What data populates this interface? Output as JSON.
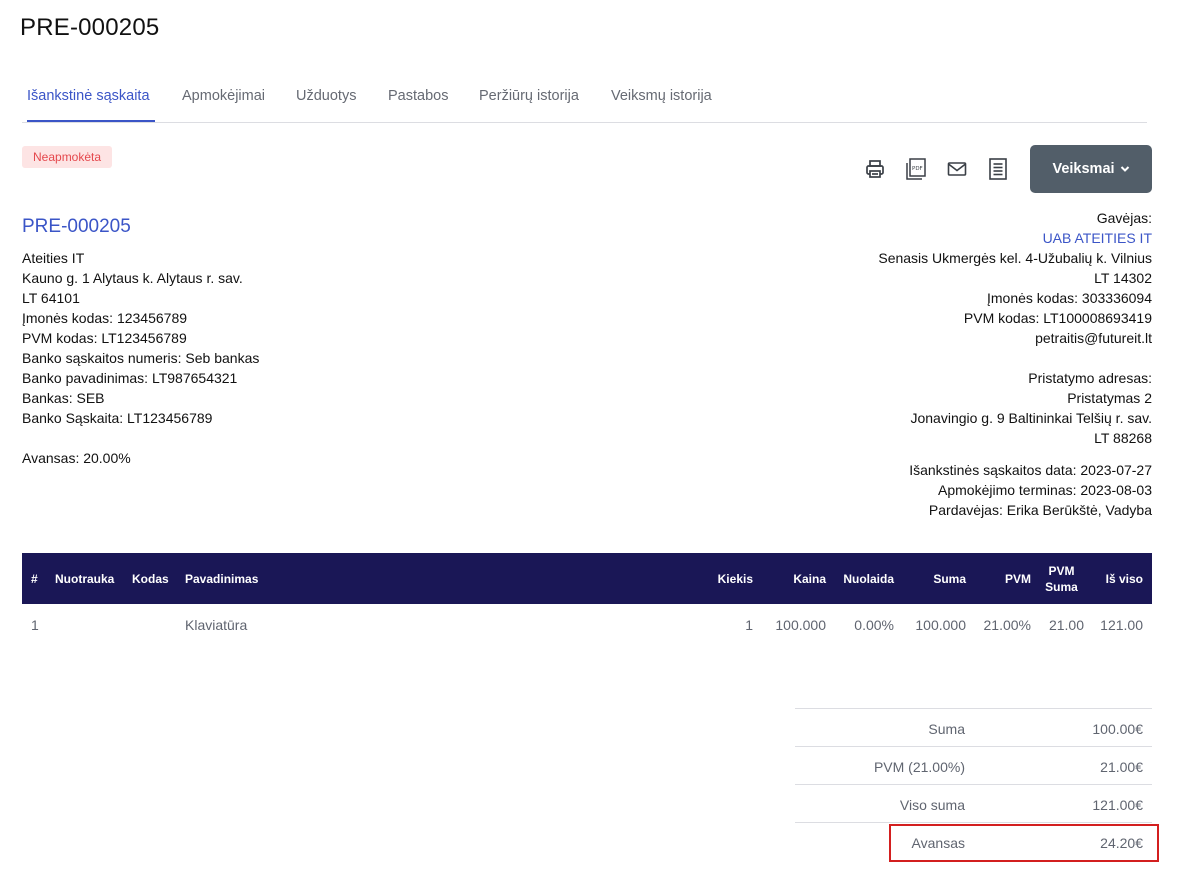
{
  "page": {
    "title": "PRE-000205"
  },
  "tabs": [
    {
      "label": "Išankstinė sąskaita"
    },
    {
      "label": "Apmokėjimai"
    },
    {
      "label": "Užduotys"
    },
    {
      "label": "Pastabos"
    },
    {
      "label": "Peržiūrų istorija"
    },
    {
      "label": "Veiksmų istorija"
    }
  ],
  "status": {
    "label": "Neapmokėta"
  },
  "toolbar": {
    "icons": [
      "printer-icon",
      "pdf-icon",
      "mail-icon",
      "receipt-icon"
    ],
    "actions_label": "Veiksmai"
  },
  "invoice": {
    "number": "PRE-000205"
  },
  "seller": {
    "name": "Ateities IT",
    "address": "Kauno g. 1 Alytaus k. Alytaus r. sav.",
    "postcode": "LT 64101",
    "company_code": "Įmonės kodas: 123456789",
    "vat_code": "PVM kodas: LT123456789",
    "bank_account_number": "Banko sąskaitos numeris: Seb bankas",
    "bank_name": "Banko pavadinimas: LT987654321",
    "bank": "Bankas: SEB",
    "bank_account": "Banko Sąskaita: LT123456789",
    "advance": "Avansas: 20.00%"
  },
  "buyer": {
    "label": "Gavėjas:",
    "name": "UAB ATEITIES IT",
    "address": "Senasis Ukmergės kel. 4-Užubalių k. Vilnius",
    "postcode": "LT 14302",
    "company_code": "Įmonės kodas: 303336094",
    "vat_code": "PVM kodas: LT100008693419",
    "email": "petraitis@futureit.lt",
    "delivery_label": "Pristatymo adresas:",
    "delivery_name": "Pristatymas 2",
    "delivery_address": "Jonavingio g. 9 Baltininkai Telšių r. sav.",
    "delivery_postcode": "LT 88268",
    "invoice_date": "Išankstinės sąskaitos data: 2023-07-27",
    "payment_term": "Apmokėjimo terminas: 2023-08-03",
    "salesperson": "Pardavėjas: Erika Berūkštė, Vadyba"
  },
  "table": {
    "headers": {
      "num": "#",
      "image": "Nuotrauka",
      "code": "Kodas",
      "name": "Pavadinimas",
      "qty": "Kiekis",
      "price": "Kaina",
      "discount": "Nuolaida",
      "sum": "Suma",
      "vat": "PVM",
      "vat_sum_1": "PVM",
      "vat_sum_2": "Suma",
      "total": "Iš viso"
    },
    "rows": [
      {
        "num": "1",
        "image": "",
        "code": "",
        "name": "Klaviatūra",
        "qty": "1",
        "price": "100.000",
        "discount": "0.00%",
        "sum": "100.000",
        "vat": "21.00%",
        "vat_sum": "21.00",
        "total": "121.00"
      }
    ]
  },
  "totals": {
    "sum_label": "Suma",
    "sum_value": "100.00€",
    "vat_label": "PVM (21.00%)",
    "vat_value": "21.00€",
    "grand_label": "Viso suma",
    "grand_value": "121.00€",
    "advance_label": "Avansas",
    "advance_value": "24.20€"
  },
  "colors": {
    "accent": "#3b55c7",
    "table_header": "#1a1756",
    "actions_button": "#525e69",
    "badge_bg": "#fde4e4",
    "badge_text": "#e5484d",
    "highlight": "#d31f1f"
  }
}
